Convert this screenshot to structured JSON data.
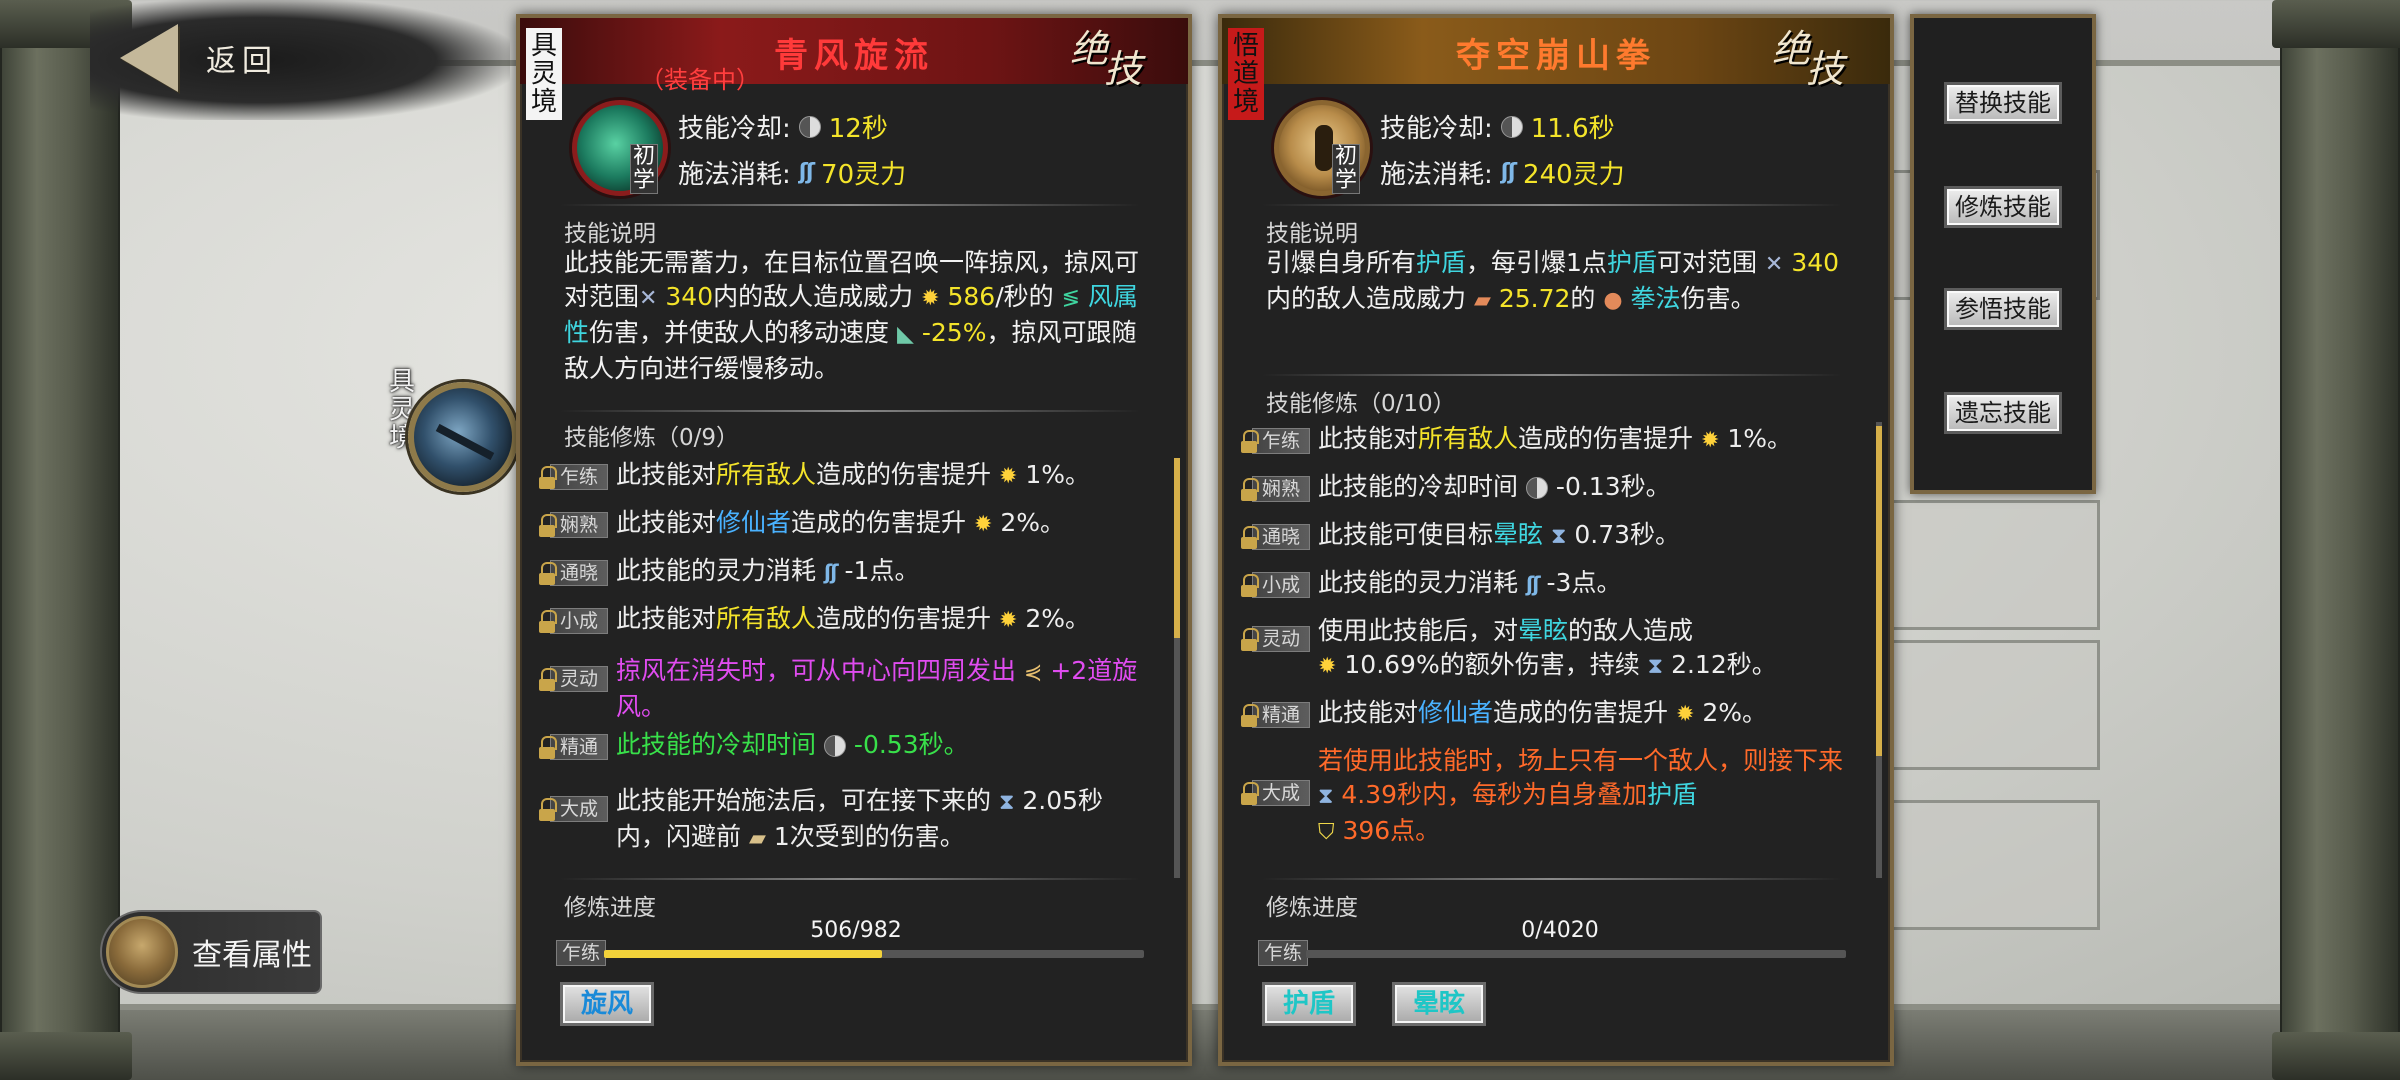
{
  "nav": {
    "back_label": "返回",
    "attributes_label": "查看属性"
  },
  "side_skill": {
    "realm": "具灵境"
  },
  "panel1": {
    "realm": "具灵境",
    "title": "青风旋流",
    "equipped": "（装备中）",
    "ult_badge": [
      "绝",
      "技"
    ],
    "rank": "初学",
    "cooldown_label": "技能冷却:",
    "cooldown_value": "12秒",
    "cost_label": "施法消耗:",
    "cost_value": "70灵力",
    "desc_title": "技能说明",
    "desc": {
      "p1": "此技能无需蓄力，在目标位置召唤一阵掠风，掠风可对范围",
      "range": "340",
      "p2": "内的敌人造成威力",
      "dmg": "586",
      "p3": "/秒的",
      "element": "风属性",
      "p4": "伤害，并使敌人的移动速度",
      "slow": "-25%",
      "p5": "，掠风可跟随敌人方向进行缓慢移动。"
    },
    "train_title": "技能修炼（0/9）",
    "train": [
      {
        "stage": "乍练",
        "a": "此技能对",
        "hl": "所有敌人",
        "b": "造成的伤害提升",
        "c": "1%。"
      },
      {
        "stage": "娴熟",
        "a": "此技能对",
        "hl": "修仙者",
        "b": "造成的伤害提升",
        "c": "2%。"
      },
      {
        "stage": "通晓",
        "a": "此技能的灵力消耗",
        "c": "-1点。"
      },
      {
        "stage": "小成",
        "a": "此技能对",
        "hl": "所有敌人",
        "b": "造成的伤害提升",
        "c": "2%。"
      },
      {
        "stage": "灵动",
        "a": "掠风在消失时，可从中心向四周发出",
        "c": "+2道旋风。"
      },
      {
        "stage": "精通",
        "a": "此技能的冷却时间",
        "c": "-0.53秒。"
      },
      {
        "stage": "大成",
        "a": "此技能开始施法后，可在接下来的",
        "b": "2.05秒内，闪避前",
        "c": "1次受到的伤害。"
      }
    ],
    "progress_title": "修炼进度",
    "progress_stage": "乍练",
    "progress_count": "506/982",
    "progress_fraction": 0.515,
    "effect_buttons": [
      "旋风"
    ]
  },
  "panel2": {
    "realm": "悟道境",
    "title": "夺空崩山拳",
    "ult_badge": [
      "绝",
      "技"
    ],
    "rank": "初学",
    "cooldown_label": "技能冷却:",
    "cooldown_value": "11.6秒",
    "cost_label": "施法消耗:",
    "cost_value": "240灵力",
    "desc_title": "技能说明",
    "desc": {
      "p1": "引爆自身所有",
      "shield": "护盾",
      "p2": "，每引爆1点",
      "p3": "可对范围",
      "range": "340",
      "p4": "内的敌人造成威力",
      "dmg": "25.72",
      "p5": "的",
      "element": "拳法",
      "p6": "伤害。"
    },
    "train_title": "技能修炼（0/10）",
    "train": [
      {
        "stage": "乍练",
        "a": "此技能对",
        "hl": "所有敌人",
        "b": "造成的伤害提升",
        "c": "1%。"
      },
      {
        "stage": "娴熟",
        "a": "此技能的冷却时间",
        "c": "-0.13秒。"
      },
      {
        "stage": "通晓",
        "a": "此技能可使目标",
        "hl": "晕眩",
        "c": "0.73秒。"
      },
      {
        "stage": "小成",
        "a": "此技能的灵力消耗",
        "c": "-3点。"
      },
      {
        "stage": "灵动",
        "a": "使用此技能后，对",
        "hl": "晕眩",
        "b": "的敌人造成",
        "c": "10.69%的额外伤害，持续",
        "d": "2.12秒。"
      },
      {
        "stage": "精通",
        "a": "此技能对",
        "hl": "修仙者",
        "b": "造成的伤害提升",
        "c": "2%。"
      },
      {
        "stage": "大成",
        "a": "若使用此技能时，场上只有一个敌人，则接下来",
        "b": "4.39秒内，每秒为自身叠加",
        "hl": "护盾",
        "c": "396点。"
      }
    ],
    "progress_title": "修炼进度",
    "progress_stage": "乍练",
    "progress_count": "0/4020",
    "progress_fraction": 0,
    "effect_buttons": [
      "护盾",
      "晕眩"
    ]
  },
  "menu": [
    "替换技能",
    "修炼技能",
    "参悟技能",
    "遗忘技能"
  ],
  "colors": {
    "value_yellow": "#f4e42a",
    "keyword_cyan": "#3fd6e0",
    "keyword_blue": "#4ab2ff",
    "special_purple": "#e04cf0",
    "special_green": "#38e04a",
    "special_orange": "#ff6a2a",
    "panel_border": "#7a6642"
  },
  "icons": {
    "cooldown": "half-moon-clock-icon",
    "mana": "spirit-wave-icon",
    "damage": "burst-star-icon",
    "range": "crossed-arrows-icon",
    "duration": "hourglass-icon",
    "lock": "padlock-icon"
  }
}
